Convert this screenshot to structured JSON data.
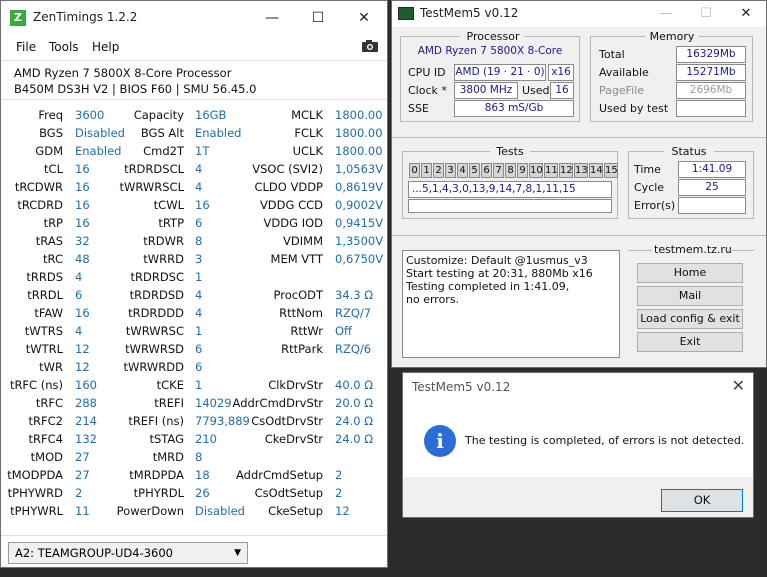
{
  "zen": {
    "title": "ZenTimings 1.2.2",
    "icon_letter": "Z",
    "menu": [
      "File",
      "Tools",
      "Help"
    ],
    "cpu": "AMD Ryzen 7 5800X 8-Core Processor",
    "board": "B450M DS3H V2 | BIOS F60 | SMU 56.45.0",
    "rows": [
      [
        "Freq",
        "3600",
        "Capacity",
        "16GB",
        "MCLK",
        "1800.00"
      ],
      [
        "BGS",
        "Disabled",
        "BGS Alt",
        "Enabled",
        "FCLK",
        "1800.00"
      ],
      [
        "GDM",
        "Enabled",
        "Cmd2T",
        "1T",
        "UCLK",
        "1800.00"
      ],
      [
        "tCL",
        "16",
        "tRDRDSCL",
        "4",
        "VSOC (SVI2)",
        "1,0563V"
      ],
      [
        "tRCDWR",
        "16",
        "tWRWRSCL",
        "4",
        "CLDO VDDP",
        "0,8619V"
      ],
      [
        "tRCDRD",
        "16",
        "tCWL",
        "16",
        "VDDG CCD",
        "0,9002V"
      ],
      [
        "tRP",
        "16",
        "tRTP",
        "6",
        "VDDG IOD",
        "0,9415V"
      ],
      [
        "tRAS",
        "32",
        "tRDWR",
        "8",
        "VDIMM",
        "1,3500V"
      ],
      [
        "tRC",
        "48",
        "tWRRD",
        "3",
        "MEM VTT",
        "0,6750V"
      ],
      [
        "tRRDS",
        "4",
        "tRDRDSC",
        "1",
        "",
        ""
      ],
      [
        "tRRDL",
        "6",
        "tRDRDSD",
        "4",
        "ProcODT",
        "34.3 Ω"
      ],
      [
        "tFAW",
        "16",
        "tRDRDDD",
        "4",
        "RttNom",
        "RZQ/7"
      ],
      [
        "tWTRS",
        "4",
        "tWRWRSC",
        "1",
        "RttWr",
        "Off"
      ],
      [
        "tWTRL",
        "12",
        "tWRWRSD",
        "6",
        "RttPark",
        "RZQ/6"
      ],
      [
        "tWR",
        "12",
        "tWRWRDD",
        "6",
        "",
        ""
      ],
      [
        "tRFC (ns)",
        "160",
        "tCKE",
        "1",
        "ClkDrvStr",
        "40.0 Ω"
      ],
      [
        "tRFC",
        "288",
        "tREFI",
        "14029",
        "AddrCmdDrvStr",
        "20.0 Ω"
      ],
      [
        "tRFC2",
        "214",
        "tREFI (ns)",
        "7793,889",
        "CsOdtDrvStr",
        "24.0 Ω"
      ],
      [
        "tRFC4",
        "132",
        "tSTAG",
        "210",
        "CkeDrvStr",
        "24.0 Ω"
      ],
      [
        "tMOD",
        "27",
        "tMRD",
        "8",
        "",
        ""
      ],
      [
        "tMODPDA",
        "27",
        "tMRDPDA",
        "18",
        "AddrCmdSetup",
        "2"
      ],
      [
        "tPHYWRD",
        "2",
        "tPHYRDL",
        "26",
        "CsOdtSetup",
        "2"
      ],
      [
        "tPHYWRL",
        "11",
        "PowerDown",
        "Disabled",
        "CkeSetup",
        "12"
      ]
    ],
    "module": "A2: TEAMGROUP-UD4-3600"
  },
  "tm": {
    "title": "TestMem5 v0.12",
    "processor_title": "Processor",
    "cpu_name": "AMD Ryzen 7 5800X 8-Core",
    "cpuid_label": "CPU ID",
    "cpuid": "AMD  (19 · 21 · 0)",
    "threads": "x16",
    "clock_label": "Clock *",
    "clock": "3800 MHz",
    "used_label": "Used",
    "used": "16",
    "sse_label": "SSE",
    "sse": "863 mS/Gb",
    "memory_title": "Memory",
    "total_label": "Total",
    "total": "16329Mb",
    "available_label": "Available",
    "available": "15271Mb",
    "pagefile_label": "PageFile",
    "pagefile": "2696Mb",
    "usedbytest_label": "Used by test",
    "tests_title": "Tests",
    "test_cells": [
      "0",
      "1",
      "2",
      "3",
      "4",
      "5",
      "6",
      "7",
      "8",
      "9",
      "10",
      "11",
      "12",
      "13",
      "14",
      "15"
    ],
    "sequence": "...5,1,4,3,0,13,9,14,7,8,1,11,15",
    "status_title": "Status",
    "time_label": "Time",
    "time": "1:41.09",
    "cycle_label": "Cycle",
    "cycle": "25",
    "errors_label": "Error(s)",
    "log": [
      "Customize: Default @1usmus_v3",
      "Start testing at 20:31, 880Mb x16",
      "Testing completed in 1:41.09,",
      "no errors."
    ],
    "site": "testmem.tz.ru",
    "buttons": [
      "Home",
      "Mail",
      "Load config & exit",
      "Exit"
    ]
  },
  "dialog": {
    "title": "TestMem5 v0.12",
    "message": "The testing is completed, of errors is not detected.",
    "ok": "OK"
  },
  "colors": {
    "value_blue": "#1f6ea8",
    "field_text": "#1a1a8a",
    "info_blue": "#2b6cd6"
  }
}
